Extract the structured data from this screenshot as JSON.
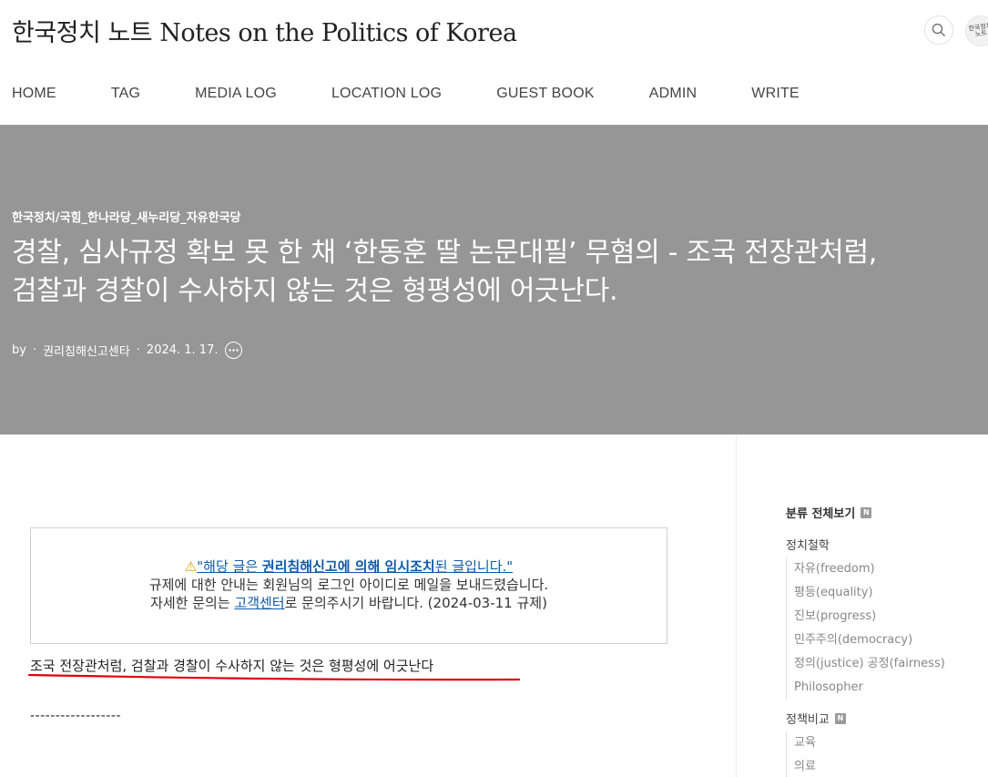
{
  "site": {
    "title": "한국정치 노트 Notes on the Politics of Korea",
    "avatar_text": "한국정치 노트"
  },
  "nav": {
    "items": [
      {
        "label": "HOME"
      },
      {
        "label": "TAG"
      },
      {
        "label": "MEDIA LOG"
      },
      {
        "label": "LOCATION LOG"
      },
      {
        "label": "GUEST BOOK"
      },
      {
        "label": "ADMIN"
      },
      {
        "label": "WRITE"
      }
    ]
  },
  "post": {
    "category": "한국정치/국힘_한나라당_새누리당_자유한국당",
    "title_line1": "경찰, 심사규정 확보 못 한 채 ‘한동훈 딸 논문대필’ 무혐의 - 조국 전장관처럼,",
    "title_line2": "검찰과 경찰이 수사하지 않는 것은 형평성에 어긋난다.",
    "by": "by",
    "author": "권리침해신고센타",
    "date": "2024. 1. 17."
  },
  "notice": {
    "warning_icon": "⚠",
    "line1_pre": "\"해당 글은 ",
    "line1_bold": "권리침해신고에 의해 임시조치",
    "line1_post": "된 글입니다.\"",
    "line2": "규제에 대한 안내는 회원님의 로그인 아이디로 메일을 보내드렸습니다.",
    "line3_pre": "자세한 문의는 ",
    "line3_link": "고객센터",
    "line3_post": "로 문의주시기 바랍니다. (2024-03-11 규제)"
  },
  "body": {
    "subheading": "조국 전장관처럼, 검찰과 경찰이 수사하지 않는 것은 형평성에 어긋난다",
    "divider": "------------------"
  },
  "sidebar": {
    "all_label": "분류 전체보기",
    "badge": "N",
    "categories": [
      {
        "label": "정치철학",
        "items": [
          "자유(freedom)",
          "평등(equality)",
          "진보(progress)",
          "민주주의(democracy)",
          "정의(justice) 공정(fairness)",
          "Philosopher"
        ]
      },
      {
        "label": "정책비교",
        "items": [
          "교육",
          "의료"
        ]
      }
    ]
  },
  "colors": {
    "hero_bg": "#969696",
    "link": "#0d5aa7",
    "underline": "#e0000b"
  }
}
